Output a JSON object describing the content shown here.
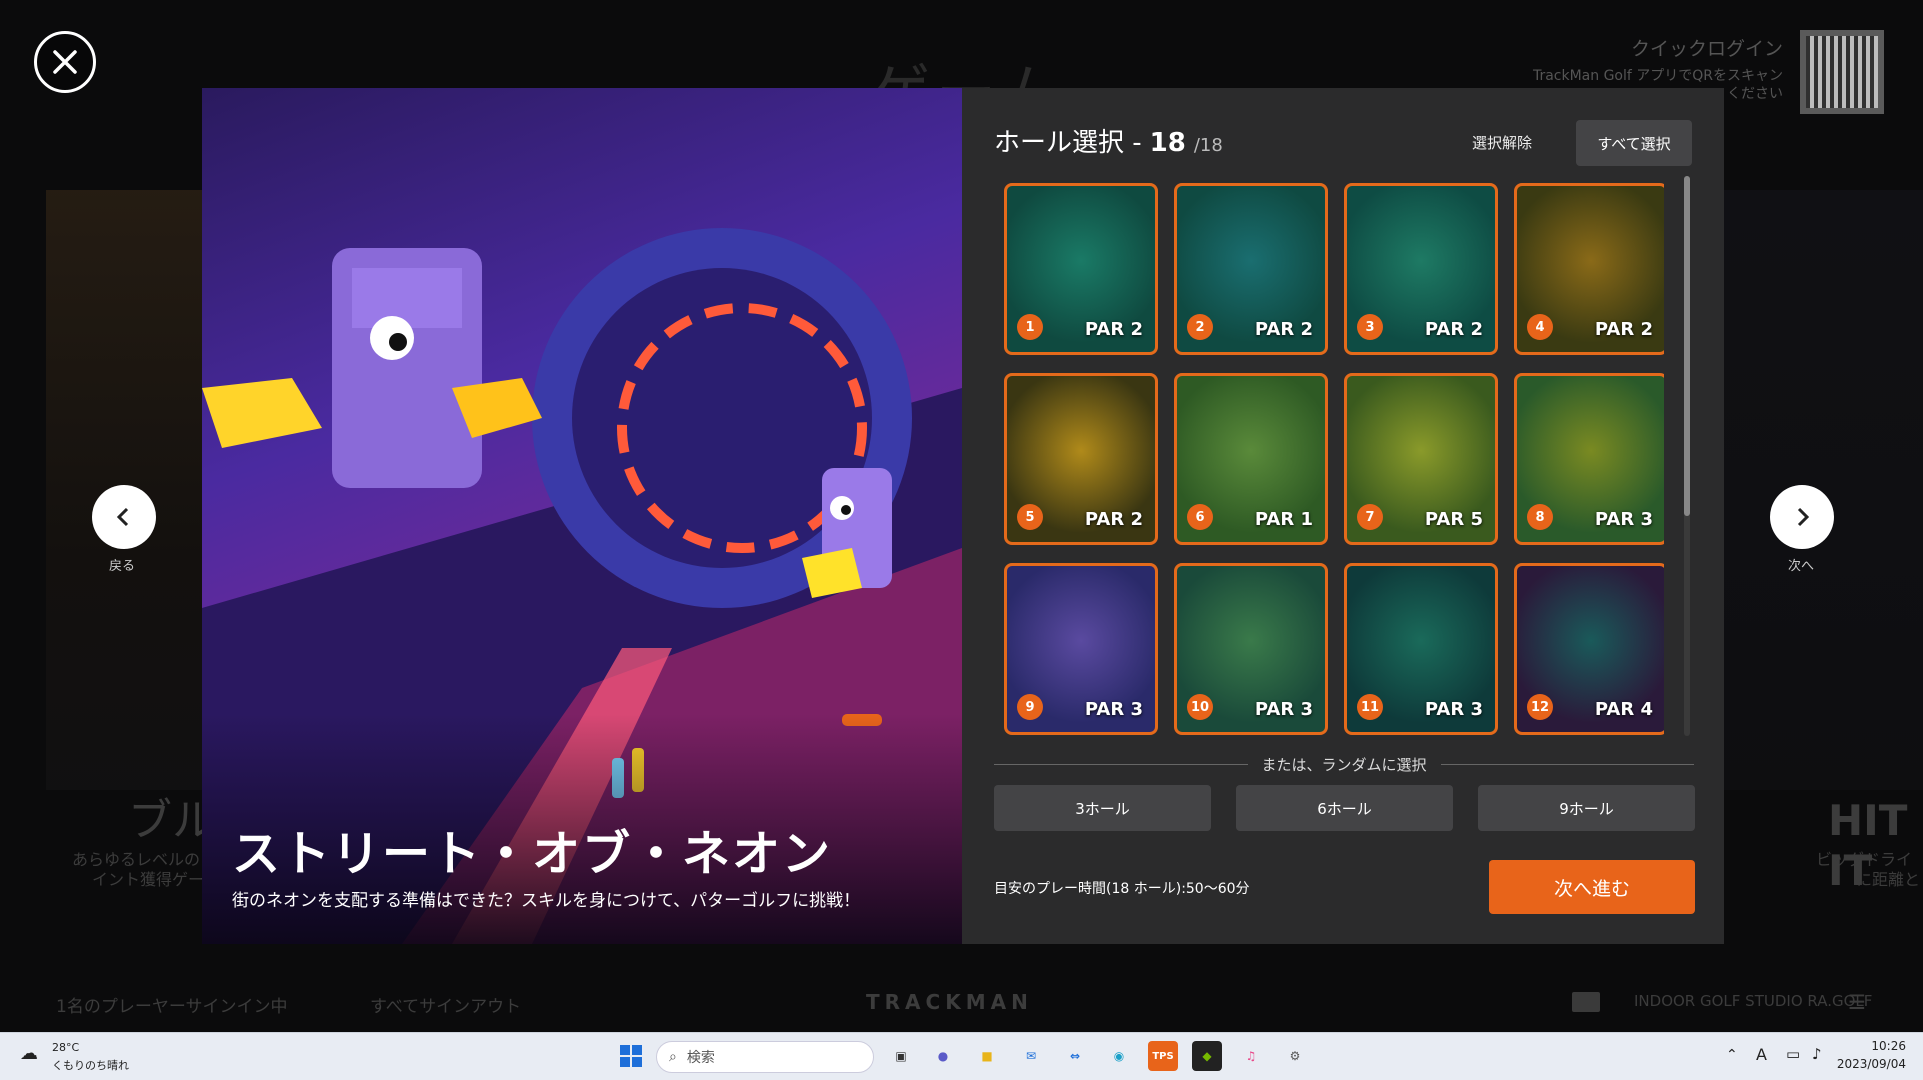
{
  "background": {
    "title": "ゲーム",
    "left_card": {
      "title": "ブル",
      "desc_line1": "あらゆるレベルの",
      "desc_line2": "イント獲得ゲー"
    },
    "right_card": {
      "title": "HIT IT",
      "desc_line1": "ビッグドライ",
      "desc_line2": "に距離と"
    },
    "quick_login": {
      "title": "クイックログイン",
      "line1": "TrackMan Golf アプリでQRをスキャン",
      "line2": "ください"
    }
  },
  "footer": {
    "players": "1名のプレーヤーサインイン中",
    "sign_out_all": "すべてサインアウト",
    "brand": "TRACKMAN",
    "studio": "INDOOR GOLF STUDIO RA.GOLF"
  },
  "game": {
    "title": "ストリート・オブ・ネオン",
    "description": "街のネオンを支配する準備はできた？スキルを身につけて、パターゴルフに挑戦！"
  },
  "hole_select": {
    "label": "ホール選択 -",
    "count": "18",
    "total": "/18",
    "clear_label": "選択解除",
    "select_all_label": "すべて選択",
    "holes": [
      {
        "num": "1",
        "par": "PAR 2",
        "c1": "#0f4a40",
        "c2": "#1a7a66"
      },
      {
        "num": "2",
        "par": "PAR 2",
        "c1": "#0f4a42",
        "c2": "#1a6e70"
      },
      {
        "num": "3",
        "par": "PAR 2",
        "c1": "#0e4c44",
        "c2": "#1e7a64"
      },
      {
        "num": "4",
        "par": "PAR 2",
        "c1": "#3a3a12",
        "c2": "#8a6a18"
      },
      {
        "num": "5",
        "par": "PAR 2",
        "c1": "#3a3612",
        "c2": "#b08a1a"
      },
      {
        "num": "6",
        "par": "PAR 1",
        "c1": "#2e5a24",
        "c2": "#5a8a3a"
      },
      {
        "num": "7",
        "par": "PAR 5",
        "c1": "#3a5a1e",
        "c2": "#8a9a2a"
      },
      {
        "num": "8",
        "par": "PAR 3",
        "c1": "#2a5a2a",
        "c2": "#7a8a22"
      },
      {
        "num": "9",
        "par": "PAR 3",
        "c1": "#2a2a6a",
        "c2": "#5a4aa0"
      },
      {
        "num": "10",
        "par": "PAR 3",
        "c1": "#1a4a3a",
        "c2": "#3a7a4a"
      },
      {
        "num": "11",
        "par": "PAR 3",
        "c1": "#0e3a3a",
        "c2": "#1a6a5a"
      },
      {
        "num": "12",
        "par": "PAR 4",
        "c1": "#2a1a3a",
        "c2": "#1a5a5a"
      }
    ],
    "random_label": "または、ランダムに選択",
    "random_options": [
      "3ホール",
      "6ホール",
      "9ホール"
    ],
    "play_time": "目安のプレー時間(18 ホール):50〜60分",
    "next_label": "次へ進む"
  },
  "nav": {
    "prev_label": "戻る",
    "next_label": "次へ"
  },
  "taskbar": {
    "weather_temp": "28°C",
    "weather_desc": "くもりのち晴れ",
    "search_placeholder": "検索",
    "ime": "A",
    "time": "10:26",
    "date": "2023/09/04"
  }
}
